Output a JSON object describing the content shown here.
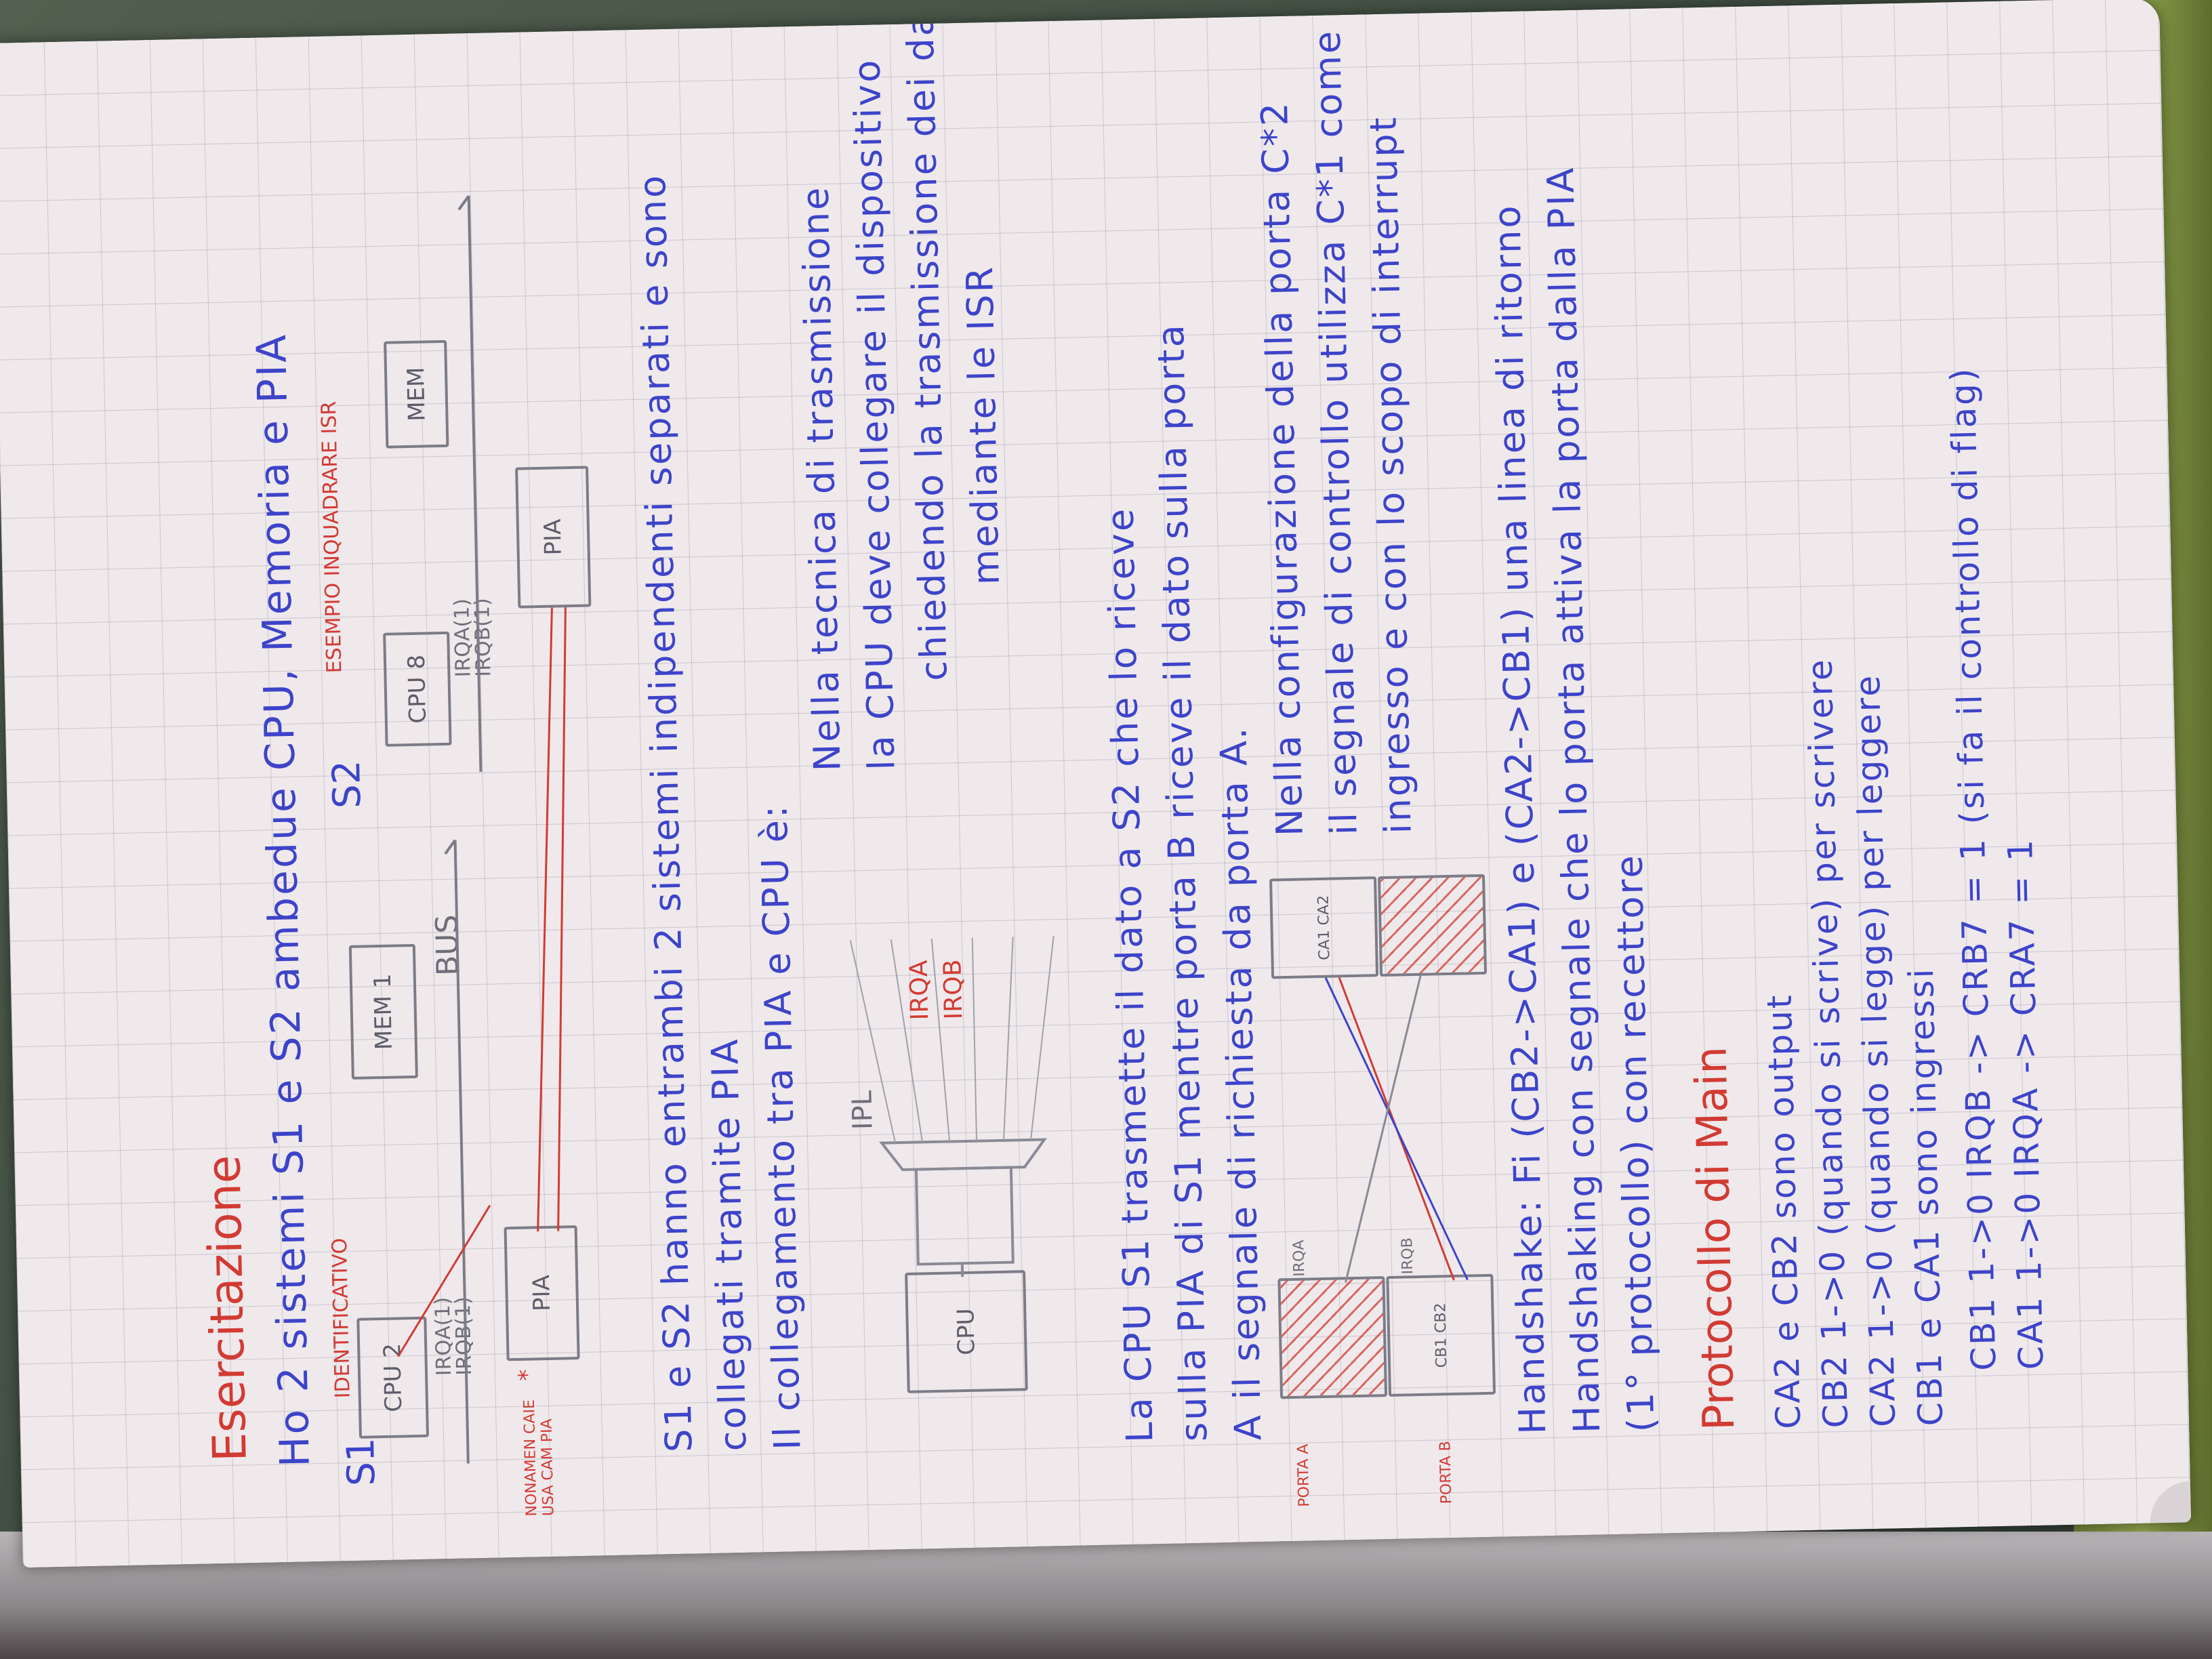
{
  "document": {
    "title": "Esercitazione",
    "intro": "Ho 2 sistemi S1 e S2 ambedue CPU, Memoria e PIA",
    "s1_label": "S1",
    "s2_label": "S2",
    "s1_diagram": {
      "cpu": "CPU 2",
      "mem": "MEM 1",
      "bus": "BUS",
      "pia": "PIA",
      "irq_a": "IRQA(1)",
      "irq_b": "IRQB(1)",
      "note_id": "IDENTIFICATIVO",
      "note_left": "NONAMEN CAIE USA CAM PIA",
      "star": "*"
    },
    "s2_diagram": {
      "cpu": "CPU 8",
      "mem": "MEM",
      "pia": "PIA",
      "note": "ESEMPIO INQUADRARE ISR",
      "irq_a": "IRQA(1)",
      "irq_b": "IRQB(1)"
    },
    "body_lines": [
      "S1 e S2 hanno entrambi 2 sistemi indipendenti separati e sono",
      "collegati tramite PIA",
      "Il collegamento tra PIA e CPU è:",
      "Nella tecnica di trasmissione",
      "la CPU deve collegare il dispositivo",
      "chiedendo la trasmissione dei dati",
      "mediante le ISR",
      "La CPU S1 trasmette il dato a S2 che lo riceve",
      "sulla PIA di S1 mentre porta B riceve il dato sulla porta",
      "A il segnale di richiesta da porta A.",
      "Nella configurazione della porta C*2",
      "il segnale di controllo utilizza C*1 come",
      "ingresso e con lo scopo di interrupt",
      "Handshake: Fi (CB2->CA1) e (CA2->CB1) una linea di ritorno",
      "Handshaking con segnale che lo porta attiva la porta dalla PIA",
      "(1° protocollo) con recettore"
    ],
    "diagram2": {
      "cpu": "CPU",
      "ipl": "IPL",
      "irqa": "IRQA",
      "irqb": "IRQB",
      "port_a": "PORTA A",
      "port_b": "PORTA B",
      "ca1": "CA1",
      "ca2": "CA2",
      "cb1": "CB1",
      "cb2": "CB2",
      "irq_a_small": "IRQA",
      "irq_b_small": "IRQB"
    },
    "section2_title": "Protocollo di Main",
    "code_lines": [
      "CA2 e CB2 sono output",
      "CB2 1->0 (quando si scrive) per scrivere",
      "CA2 1->0 (quando si legge) per leggere",
      "CB1 e CA1 sono ingressi",
      "CB1 1->0 IRQB -> CRB7 = 1 (si fa il controllo di flag)",
      "CA1 1->0 IRQA -> CRA7 = 1"
    ]
  }
}
